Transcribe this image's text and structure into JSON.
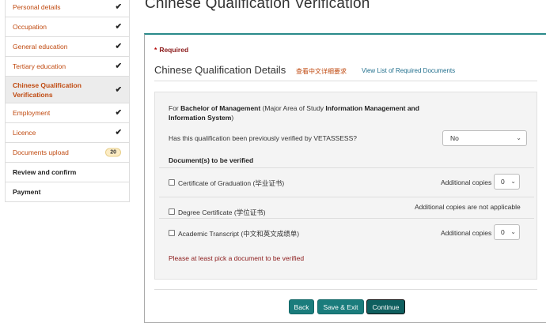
{
  "sidebar": {
    "items": [
      {
        "label": "Personal details",
        "status": "check"
      },
      {
        "label": "Occupation",
        "status": "check"
      },
      {
        "label": "General education",
        "status": "check"
      },
      {
        "label": "Tertiary education",
        "status": "check"
      },
      {
        "label": "Chinese Qualification Verifications",
        "status": "check"
      },
      {
        "label": "Employment",
        "status": "check"
      },
      {
        "label": "Licence",
        "status": "check"
      },
      {
        "label": "Documents upload",
        "badge": "20"
      },
      {
        "label": "Review and confirm"
      },
      {
        "label": "Payment"
      }
    ]
  },
  "page": {
    "title": "Chinese Qualification Verification"
  },
  "form": {
    "required_label": "Required",
    "section_title": "Chinese Qualification Details",
    "link_cn": "查看中文详细要求",
    "link_docs": "View List of Required Documents",
    "for_prefix": "For ",
    "degree": "Bachelor of Management",
    "major_prefix": " (Major Area of Study ",
    "major": "Information Management and Information System",
    "major_suffix": ")",
    "question": "Has this qualification been previously verified by VETASSESS?",
    "verified_value": "No",
    "docs_title": "Document(s) to be verified",
    "documents": [
      {
        "label": "Certificate of Graduation (毕业证书)",
        "copies_label": "Additional copies",
        "copies_value": "0"
      },
      {
        "label": "Degree Certificate (学位证书)",
        "copies_label": "Additional copies are not applicable"
      },
      {
        "label": "Academic Transcript (中文和英文成绩单)",
        "copies_label": "Additional copies",
        "copies_value": "0"
      }
    ],
    "error": "Please at least pick a document to be verified"
  },
  "buttons": {
    "back": "Back",
    "save_exit": "Save & Exit",
    "continue": "Continue"
  },
  "colors": {
    "accent": "#1a7c7c",
    "link_orange": "#c04a10",
    "error": "#8b1a1a"
  }
}
